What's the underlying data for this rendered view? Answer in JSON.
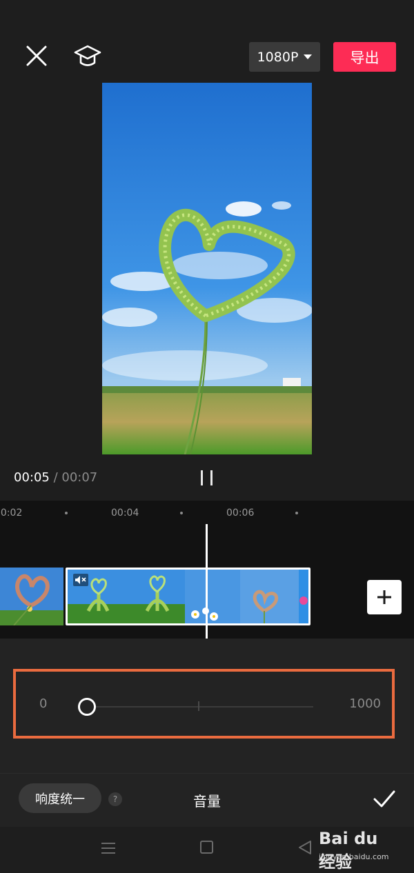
{
  "header": {
    "resolution_label": "1080P",
    "export_label": "导出"
  },
  "player": {
    "current_time": "00:05",
    "separator": " / ",
    "total_time": "00:07"
  },
  "timeline": {
    "ticks": [
      "00:02",
      "00:04",
      "00:06"
    ]
  },
  "volume_slider": {
    "min_label": "0",
    "max_label": "1000",
    "value_fraction": 0.0
  },
  "bottom_bar": {
    "normalize_label": "响度统一",
    "help_label": "?",
    "title": "音量"
  },
  "watermark": {
    "logo": "Bai du 经验",
    "url": "jingyan.baidu.com"
  },
  "colors": {
    "accent": "#fd2c55",
    "highlight_border": "#ea6b3f",
    "background": "#1e1e1e"
  }
}
